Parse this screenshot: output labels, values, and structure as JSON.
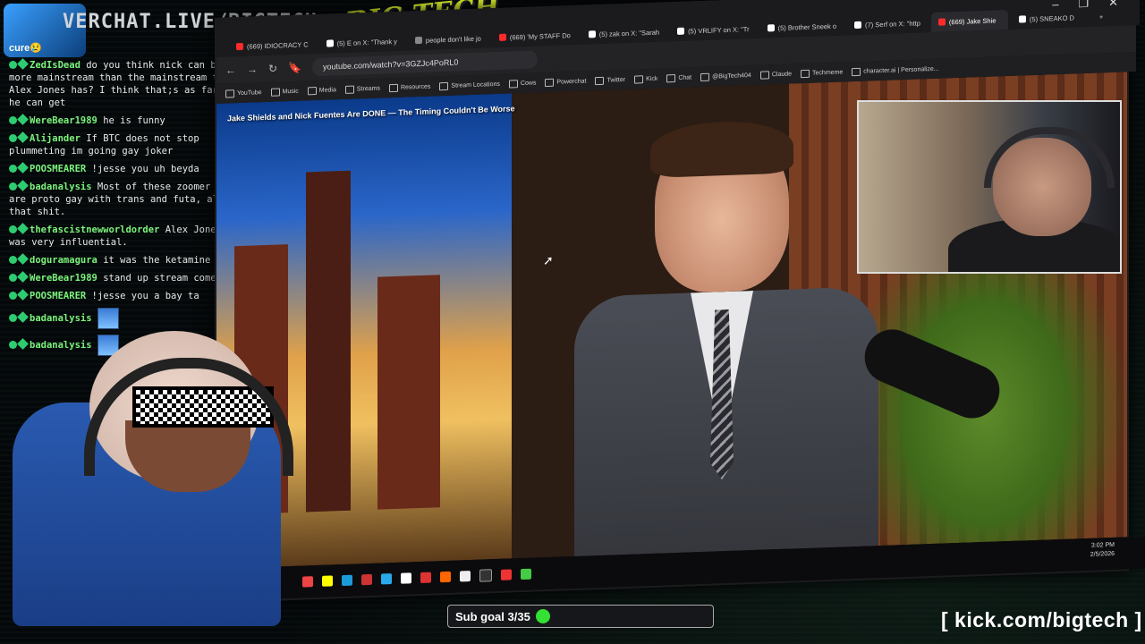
{
  "header": {
    "url_text": "VERCHAT.LIVE/BIGTECH",
    "logo_text": "BIG TECH",
    "badge_text": "cure😢"
  },
  "chat": [
    {
      "user": "ZedIsDead",
      "text": "do you think nick can be more mainstream than the mainstream that Alex Jones has? I think that;s as far as he can get",
      "badges": 1
    },
    {
      "user": "WereBear1989",
      "text": "he is funny",
      "badges": 1
    },
    {
      "user": "Alijander",
      "text": "If BTC does not stop plummeting im going gay joker",
      "badges": 1
    },
    {
      "user": "POOSMEARER",
      "text": "!jesse you uh beyda",
      "badges": 2
    },
    {
      "user": "badanalysis",
      "text": "Most of these zoomer men are proto gay with trans and futa, all that shit.",
      "badges": 1
    },
    {
      "user": "thefascistnewworldorder",
      "text": "Alex Jones was very influential.",
      "badges": 2
    },
    {
      "user": "doguramagura",
      "text": "it was the ketamine",
      "badges": 1
    },
    {
      "user": "WereBear1989",
      "text": "stand up stream comedy",
      "badges": 1
    },
    {
      "user": "POOSMEARER",
      "text": "!jesse you a bay ta",
      "badges": 2
    },
    {
      "user": "badanalysis",
      "text": "",
      "badges": 1,
      "emote": true
    },
    {
      "user": "badanalysis",
      "text": "",
      "badges": 1,
      "emote": true
    }
  ],
  "browser": {
    "tabs": [
      {
        "label": "(669) IDIOCRACY C",
        "color": "#ff2a2a"
      },
      {
        "label": "(5) E on X: \"Thank y",
        "color": "#ffffff"
      },
      {
        "label": "people don't like jo",
        "color": "#888888"
      },
      {
        "label": "(669) 'My STAFF Do",
        "color": "#ff2a2a"
      },
      {
        "label": "(5) zak on X: \"Sarah",
        "color": "#ffffff"
      },
      {
        "label": "(5) VRLIFY on X: \"Tr",
        "color": "#ffffff"
      },
      {
        "label": "(5) Brother Sneek o",
        "color": "#ffffff"
      },
      {
        "label": "(7) Serf on X: \"http",
        "color": "#ffffff"
      },
      {
        "label": "(669) Jake Shie",
        "color": "#ff2a2a",
        "active": true
      },
      {
        "label": "(5) SNEAKO D",
        "color": "#ffffff"
      }
    ],
    "new_tab": "+",
    "address": "youtube.com/watch?v=3GZJc4PoRL0",
    "bookmarks": [
      "YouTube",
      "Music",
      "Media",
      "Streams",
      "Resources",
      "Stream Locations",
      "Cows",
      "Powerchat",
      "Twitter",
      "Kick",
      "Chat",
      "@BigTech404",
      "Claude",
      "Techmeme",
      "character.ai | Personalize..."
    ],
    "video_title": "Jake Shields and Nick Fuentes Are DONE — The Timing Couldn't Be Worse",
    "clock_time": "3:02 PM",
    "clock_date": "2/5/2026"
  },
  "footer": {
    "sub_goal": "Sub goal 3/35",
    "kick_url": "[ kick.com/bigtech ]"
  },
  "colors": {
    "username": "#7cf37c",
    "logo": "#e6ff2a",
    "goal_dot": "#33e033"
  }
}
